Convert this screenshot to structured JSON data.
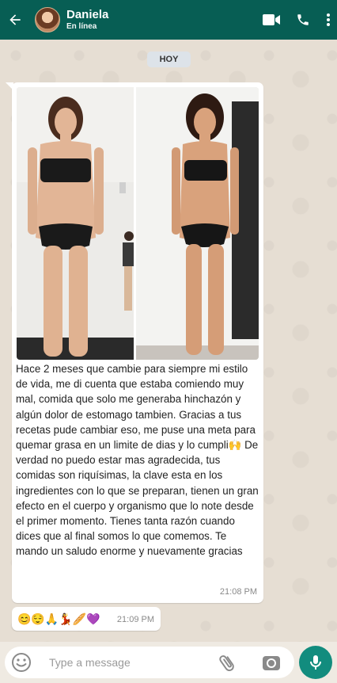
{
  "header": {
    "contact_name": "Daniela",
    "status": "En línea",
    "bg_color": "#075e54",
    "icons": [
      "back-arrow-icon",
      "video-call-icon",
      "phone-icon",
      "more-vert-icon"
    ]
  },
  "chat": {
    "date_chip": "HOY",
    "message": {
      "text": "Hace 2 meses que cambie para siempre mi estilo de vida, me di cuenta que estaba comiendo muy mal, comida que solo me generaba hinchazón y algún dolor de estomago tambien. Gracias a tus recetas pude cambiar eso, me puse una meta para quemar grasa en un limite de dias y lo cumpli🙌 De verdad no puedo estar mas agradecida, tus comidas son riquísimas, la clave esta en los ingredientes con lo que se preparan, tienen un gran efecto en el cuerpo y organismo que lo note desde el primer momento. Tienes tanta razón cuando dices que al final somos lo que comemos. Te mando un saludo enorme y nuevamente gracias",
      "time": "21:08 PM"
    },
    "emoji_message": {
      "emojis": "😊😌🙏💃🥖💜",
      "time": "21:09 PM"
    }
  },
  "input": {
    "placeholder": "Type a message",
    "accent": "#128c7e"
  }
}
